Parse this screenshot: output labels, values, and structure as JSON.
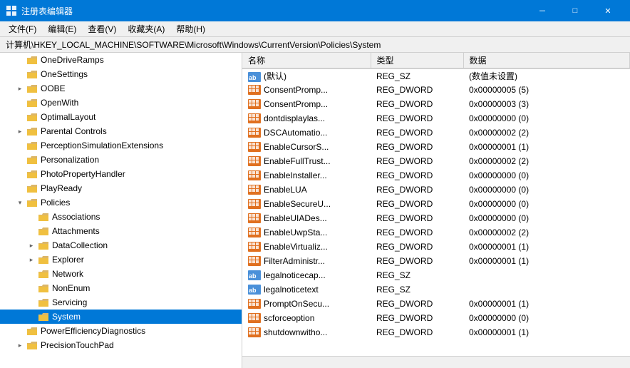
{
  "titleBar": {
    "icon": "📋",
    "title": "注册表编辑器",
    "minimize": "－",
    "maximize": "□",
    "close": "✕"
  },
  "menuBar": {
    "items": [
      "文件(F)",
      "编辑(E)",
      "查看(V)",
      "收藏夹(A)",
      "帮助(H)"
    ]
  },
  "addressBar": {
    "label": "计算机\\HKEY_LOCAL_MACHINE\\SOFTWARE\\Microsoft\\Windows\\CurrentVersion\\Policies\\System"
  },
  "treeItems": [
    {
      "id": "OneDriveRamps",
      "label": "OneDriveRamps",
      "indent": 1,
      "toggle": "empty",
      "expanded": false
    },
    {
      "id": "OneSettings",
      "label": "OneSettings",
      "indent": 1,
      "toggle": "empty",
      "expanded": false
    },
    {
      "id": "OOBE",
      "label": "OOBE",
      "indent": 1,
      "toggle": "collapsed",
      "expanded": false
    },
    {
      "id": "OpenWith",
      "label": "OpenWith",
      "indent": 1,
      "toggle": "empty",
      "expanded": false
    },
    {
      "id": "OptimalLayout",
      "label": "OptimalLayout",
      "indent": 1,
      "toggle": "empty",
      "expanded": false
    },
    {
      "id": "ParentalControls",
      "label": "Parental Controls",
      "indent": 1,
      "toggle": "collapsed",
      "expanded": false
    },
    {
      "id": "PerceptionSimulationExtensions",
      "label": "PerceptionSimulationExtensions",
      "indent": 1,
      "toggle": "empty",
      "expanded": false
    },
    {
      "id": "Personalization",
      "label": "Personalization",
      "indent": 1,
      "toggle": "empty",
      "expanded": false
    },
    {
      "id": "PhotoPropertyHandler",
      "label": "PhotoPropertyHandler",
      "indent": 1,
      "toggle": "empty",
      "expanded": false
    },
    {
      "id": "PlayReady",
      "label": "PlayReady",
      "indent": 1,
      "toggle": "empty",
      "expanded": false
    },
    {
      "id": "Policies",
      "label": "Policies",
      "indent": 1,
      "toggle": "expanded",
      "expanded": true
    },
    {
      "id": "Associations",
      "label": "Associations",
      "indent": 2,
      "toggle": "empty",
      "expanded": false
    },
    {
      "id": "Attachments",
      "label": "Attachments",
      "indent": 2,
      "toggle": "empty",
      "expanded": false
    },
    {
      "id": "DataCollection",
      "label": "DataCollection",
      "indent": 2,
      "toggle": "collapsed",
      "expanded": false
    },
    {
      "id": "Explorer",
      "label": "Explorer",
      "indent": 2,
      "toggle": "collapsed",
      "expanded": false
    },
    {
      "id": "Network",
      "label": "Network",
      "indent": 2,
      "toggle": "empty",
      "expanded": false
    },
    {
      "id": "NonEnum",
      "label": "NonEnum",
      "indent": 2,
      "toggle": "empty",
      "expanded": false
    },
    {
      "id": "Servicing",
      "label": "Servicing",
      "indent": 2,
      "toggle": "empty",
      "expanded": false
    },
    {
      "id": "System",
      "label": "System",
      "indent": 2,
      "toggle": "empty",
      "expanded": false,
      "selected": true
    },
    {
      "id": "PowerEfficiencyDiagnostics",
      "label": "PowerEfficiencyDiagnostics",
      "indent": 1,
      "toggle": "empty",
      "expanded": false
    },
    {
      "id": "PrecisionTouchPad",
      "label": "PrecisionTouchPad",
      "indent": 1,
      "toggle": "collapsed",
      "expanded": false
    }
  ],
  "tableHeaders": [
    "名称",
    "类型",
    "数据"
  ],
  "tableRows": [
    {
      "name": "(默认)",
      "nameIcon": "ab",
      "type": "REG_SZ",
      "data": "(数值未设置)"
    },
    {
      "name": "ConsentPromp...",
      "nameIcon": "dword",
      "type": "REG_DWORD",
      "data": "0x00000005 (5)"
    },
    {
      "name": "ConsentPromp...",
      "nameIcon": "dword",
      "type": "REG_DWORD",
      "data": "0x00000003 (3)"
    },
    {
      "name": "dontdisplaylas...",
      "nameIcon": "dword",
      "type": "REG_DWORD",
      "data": "0x00000000 (0)"
    },
    {
      "name": "DSCAutomatio...",
      "nameIcon": "dword",
      "type": "REG_DWORD",
      "data": "0x00000002 (2)"
    },
    {
      "name": "EnableCursorS...",
      "nameIcon": "dword",
      "type": "REG_DWORD",
      "data": "0x00000001 (1)"
    },
    {
      "name": "EnableFullTrust...",
      "nameIcon": "dword",
      "type": "REG_DWORD",
      "data": "0x00000002 (2)"
    },
    {
      "name": "EnableInstaller...",
      "nameIcon": "dword",
      "type": "REG_DWORD",
      "data": "0x00000000 (0)"
    },
    {
      "name": "EnableLUA",
      "nameIcon": "dword",
      "type": "REG_DWORD",
      "data": "0x00000000 (0)"
    },
    {
      "name": "EnableSecureU...",
      "nameIcon": "dword",
      "type": "REG_DWORD",
      "data": "0x00000000 (0)"
    },
    {
      "name": "EnableUIADes...",
      "nameIcon": "dword",
      "type": "REG_DWORD",
      "data": "0x00000000 (0)"
    },
    {
      "name": "EnableUwpSta...",
      "nameIcon": "dword",
      "type": "REG_DWORD",
      "data": "0x00000002 (2)"
    },
    {
      "name": "EnableVirtualiz...",
      "nameIcon": "dword",
      "type": "REG_DWORD",
      "data": "0x00000001 (1)"
    },
    {
      "name": "FilterAdministr...",
      "nameIcon": "dword",
      "type": "REG_DWORD",
      "data": "0x00000001 (1)"
    },
    {
      "name": "legalnoticecap...",
      "nameIcon": "ab",
      "type": "REG_SZ",
      "data": ""
    },
    {
      "name": "legalnoticetext",
      "nameIcon": "ab",
      "type": "REG_SZ",
      "data": ""
    },
    {
      "name": "PromptOnSecu...",
      "nameIcon": "dword",
      "type": "REG_DWORD",
      "data": "0x00000001 (1)"
    },
    {
      "name": "scforceoption",
      "nameIcon": "dword",
      "type": "REG_DWORD",
      "data": "0x00000000 (0)"
    },
    {
      "name": "shutdownwitho...",
      "nameIcon": "dword",
      "type": "REG_DWORD",
      "data": "0x00000001 (1)"
    }
  ]
}
